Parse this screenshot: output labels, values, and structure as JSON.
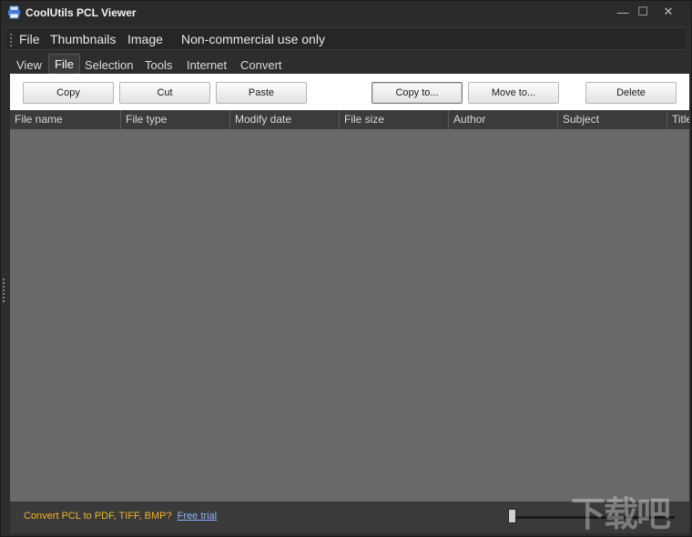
{
  "window": {
    "title": "CoolUtils PCL Viewer"
  },
  "menu": {
    "items": [
      "File",
      "Thumbnails",
      "Image",
      "Non-commercial use only"
    ]
  },
  "tabs": [
    "View",
    "File",
    "Selection",
    "Tools",
    "Internet",
    "Convert"
  ],
  "active_tab": "File",
  "toolbar": {
    "copy": "Copy",
    "cut": "Cut",
    "paste": "Paste",
    "copy_to": "Copy to...",
    "move_to": "Move to...",
    "delete": "Delete"
  },
  "grid": {
    "columns": [
      "File name",
      "File type",
      "Modify date",
      "File size",
      "Author",
      "Subject",
      "Title"
    ]
  },
  "status": {
    "promo": "Convert PCL to PDF, TIFF, BMP?",
    "link": "Free trial",
    "zoom_fraction": 0.0
  },
  "watermark": {
    "text": "下载吧"
  },
  "colors": {
    "accent_promo": "#f0b429",
    "link": "#8db4ff"
  }
}
